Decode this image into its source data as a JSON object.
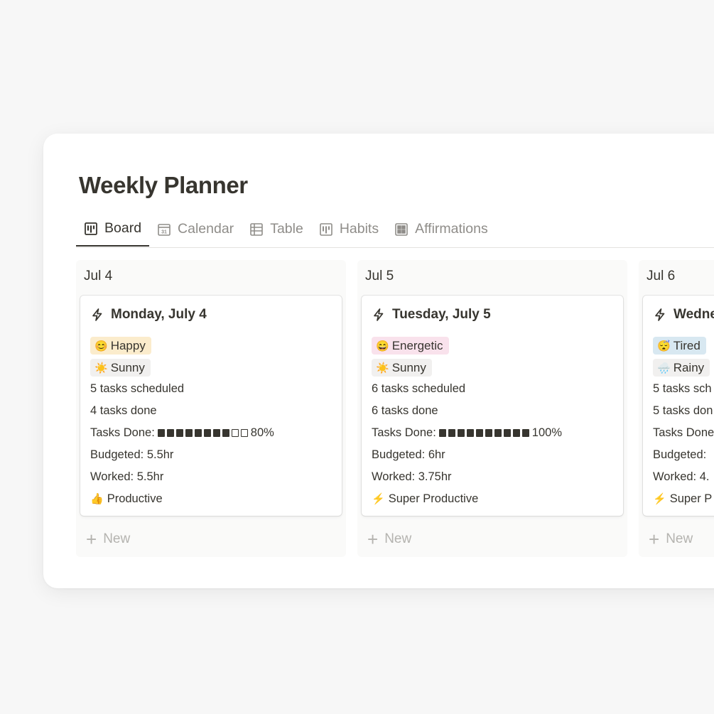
{
  "page": {
    "title": "Weekly Planner"
  },
  "tabs": [
    {
      "label": "Board",
      "icon": "board-icon",
      "active": true
    },
    {
      "label": "Calendar",
      "icon": "calendar-icon",
      "active": false
    },
    {
      "label": "Table",
      "icon": "table-icon",
      "active": false
    },
    {
      "label": "Habits",
      "icon": "board-icon",
      "active": false
    },
    {
      "label": "Affirmations",
      "icon": "gallery-icon",
      "active": false
    }
  ],
  "calendar_icon_text": "31",
  "colors": {
    "yellow_tag": "#fbeccc",
    "pink_tag": "#f9e2ec",
    "gray_tag": "#f1f0ef",
    "blue_tag": "#d8e8f1",
    "text": "#37352f",
    "muted": "#8f8d89"
  },
  "columns": [
    {
      "header": "Jul 4",
      "card": {
        "title": "Monday, July 4",
        "icon": "lightning-icon",
        "mood": {
          "emoji": "😊",
          "label": "Happy",
          "color": "#fbeccc"
        },
        "weather": {
          "emoji": "☀️",
          "label": "Sunny",
          "color": "#f1f0ef"
        },
        "tasks_scheduled": "5 tasks scheduled",
        "tasks_done": "4 tasks done",
        "progress_label": "Tasks Done:",
        "progress_filled": 8,
        "progress_total": 10,
        "progress_text": "80%",
        "budgeted": "Budgeted: 5.5hr",
        "worked": "Worked: 5.5hr",
        "productivity": {
          "emoji": "👍",
          "label": "Productive"
        }
      },
      "new_label": "New"
    },
    {
      "header": "Jul 5",
      "card": {
        "title": "Tuesday, July 5",
        "icon": "lightning-icon",
        "mood": {
          "emoji": "😄",
          "label": "Energetic",
          "color": "#f9e2ec"
        },
        "weather": {
          "emoji": "☀️",
          "label": "Sunny",
          "color": "#f1f0ef"
        },
        "tasks_scheduled": "6 tasks scheduled",
        "tasks_done": "6 tasks done",
        "progress_label": "Tasks Done:",
        "progress_filled": 10,
        "progress_total": 10,
        "progress_text": "100%",
        "budgeted": "Budgeted: 6hr",
        "worked": "Worked: 3.75hr",
        "productivity": {
          "emoji": "⚡",
          "label": "Super Productive"
        }
      },
      "new_label": "New"
    },
    {
      "header": "Jul 6",
      "card": {
        "title": "Wedne",
        "icon": "lightning-icon",
        "mood": {
          "emoji": "😴",
          "label": "Tired",
          "color": "#d8e8f1"
        },
        "weather": {
          "emoji": "🌧️",
          "label": "Rainy",
          "color": "#f1f0ef"
        },
        "tasks_scheduled": "5 tasks sch",
        "tasks_done": "5 tasks don",
        "progress_label": "Tasks Done",
        "progress_filled": 0,
        "progress_total": 0,
        "progress_text": "",
        "budgeted": "Budgeted:",
        "worked": "Worked: 4.",
        "productivity": {
          "emoji": "⚡",
          "label": "Super P"
        }
      },
      "new_label": "New"
    }
  ]
}
